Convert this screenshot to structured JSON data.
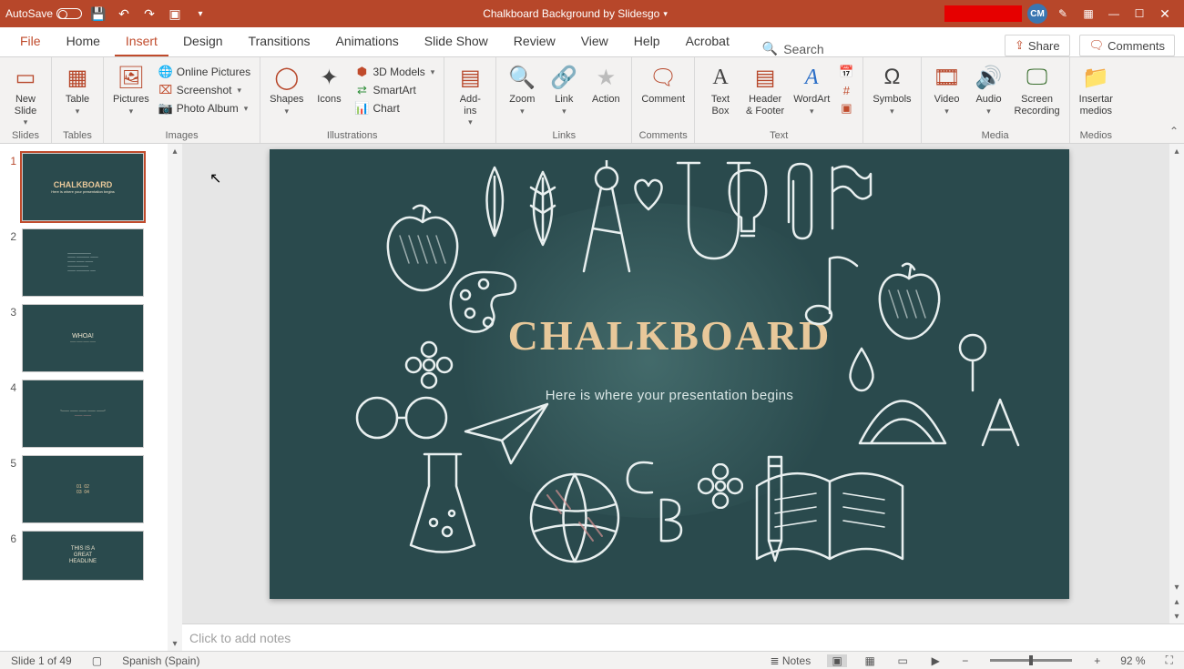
{
  "titlebar": {
    "autosave_label": "AutoSave",
    "autosave_state": "Off",
    "doc_title": "Chalkboard Background by Slidesgo",
    "avatar_initials": "CM"
  },
  "tabs": {
    "file": "File",
    "home": "Home",
    "insert": "Insert",
    "design": "Design",
    "transitions": "Transitions",
    "animations": "Animations",
    "slideshow": "Slide Show",
    "review": "Review",
    "view": "View",
    "help": "Help",
    "acrobat": "Acrobat",
    "search": "Search",
    "share": "Share",
    "comments": "Comments",
    "active": "insert"
  },
  "ribbon": {
    "slides": {
      "label": "Slides",
      "new_slide": "New\nSlide"
    },
    "tables": {
      "label": "Tables",
      "table": "Table"
    },
    "images": {
      "label": "Images",
      "pictures": "Pictures",
      "online": "Online Pictures",
      "screenshot": "Screenshot",
      "album": "Photo Album"
    },
    "illustrations": {
      "label": "Illustrations",
      "shapes": "Shapes",
      "icons": "Icons",
      "models": "3D Models",
      "smartart": "SmartArt",
      "chart": "Chart"
    },
    "addins": {
      "label": "",
      "addins": "Add-\nins"
    },
    "links": {
      "label": "Links",
      "zoom": "Zoom",
      "link": "Link",
      "action": "Action"
    },
    "comments": {
      "label": "Comments",
      "comment": "Comment"
    },
    "text": {
      "label": "Text",
      "textbox": "Text\nBox",
      "header": "Header\n& Footer",
      "wordart": "WordArt"
    },
    "symbols": {
      "label": "",
      "symbols": "Symbols"
    },
    "media": {
      "label": "Media",
      "video": "Video",
      "audio": "Audio",
      "screen": "Screen\nRecording"
    },
    "medios": {
      "label": "Medios",
      "insertar": "Insertar\nmedios"
    }
  },
  "thumbs": {
    "count": 6,
    "selected": 1
  },
  "slide_content": {
    "title": "CHALKBOARD",
    "subtitle": "Here is where your presentation begins"
  },
  "notes": {
    "placeholder": "Click to add notes"
  },
  "status": {
    "slide_info": "Slide 1 of 49",
    "language": "Spanish (Spain)",
    "notes_btn": "Notes",
    "zoom_pct": "92 %"
  }
}
